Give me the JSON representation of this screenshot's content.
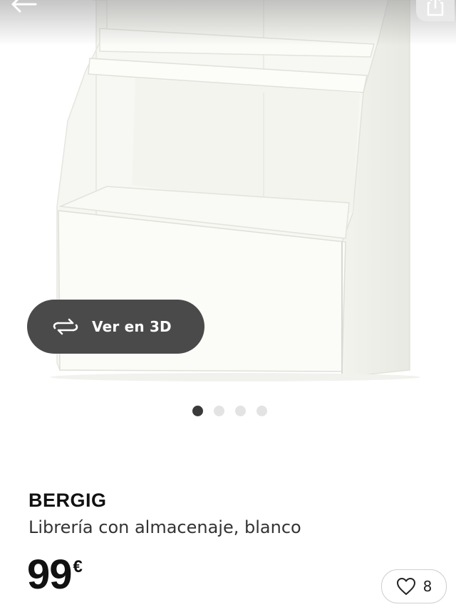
{
  "header": {
    "back_icon": "arrow-left-icon",
    "share_icon": "share-icon"
  },
  "gallery": {
    "view3d_label": "Ver en 3D",
    "view3d_icon": "rotate-3d-icon",
    "slide_count": 4,
    "active_slide": 1
  },
  "product": {
    "brand": "BERGIG",
    "description": "Librería con almacenaje, blanco",
    "price_amount": "99",
    "price_currency": "€",
    "favorite_count": "8",
    "favorite_icon": "heart-icon"
  },
  "colors": {
    "pill_bg": "#4a4a4a",
    "dot_active": "#3a3a3a",
    "dot_inactive": "#e3e3e3"
  }
}
